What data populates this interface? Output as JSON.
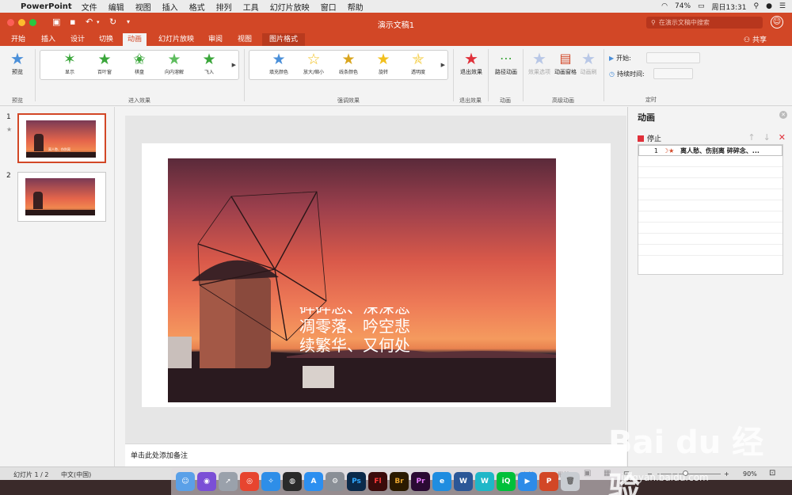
{
  "menubar": {
    "app_name": "PowerPoint",
    "items": [
      "文件",
      "编辑",
      "视图",
      "插入",
      "格式",
      "排列",
      "工具",
      "幻灯片放映",
      "窗口",
      "帮助"
    ],
    "battery": "74%",
    "clock": "周日13:31"
  },
  "window": {
    "title": "演示文稿1",
    "search_placeholder": "在演示文稿中搜索",
    "share_label": "共享"
  },
  "tabs": [
    "开始",
    "插入",
    "设计",
    "切换",
    "动画",
    "幻灯片放映",
    "审阅",
    "视图",
    "图片格式"
  ],
  "active_tab": "动画",
  "ribbon": {
    "preview": {
      "label": "预览",
      "group": "预览"
    },
    "entrance": {
      "group": "进入效果",
      "items": [
        "显示",
        "百叶窗",
        "棋盘",
        "向内溶解",
        "飞入"
      ]
    },
    "emphasis": {
      "group": "强调效果",
      "items": [
        "填充颜色",
        "放大/缩小",
        "线条颜色",
        "旋转",
        "透明度"
      ]
    },
    "exit": {
      "label": "退出效果",
      "group": "退出效果"
    },
    "path": {
      "label": "路径动画",
      "group": "动画"
    },
    "advanced": {
      "group": "高级动画",
      "effect_options": "效果选项",
      "animation_pane": "动画窗格",
      "animation_painter": "动画刷"
    },
    "timing": {
      "group": "定时",
      "start_label": "开始:",
      "duration_label": "持续时间:"
    }
  },
  "thumbnails": [
    {
      "number": "1",
      "caption": "离人愁、伤别离"
    },
    {
      "number": "2"
    }
  ],
  "slide": {
    "poem_clipped": "碎碎念、深深悲",
    "poem_lines": [
      "凋零落、吟空悲",
      "续繁华、又何处"
    ]
  },
  "notes_placeholder": "单击此处添加备注",
  "animation_pane": {
    "title": "动画",
    "stop_label": "停止",
    "entries": [
      {
        "order": "1",
        "text": "离人愁、伤别离 碎碎念、..."
      }
    ]
  },
  "statusbar": {
    "slide_info": "幻灯片 1 / 2",
    "language": "中文(中国)",
    "notes": "备注",
    "comments": "批注",
    "zoom_minus": "−",
    "zoom_plus": "+",
    "zoom": "90%"
  },
  "dock": {
    "icons": [
      "Finder",
      "Siri",
      "Launchpad",
      "Chrome",
      "Safari",
      "QQ",
      "App Store",
      "System Preferences",
      "Ps",
      "Fl",
      "Br",
      "Pr",
      "Browser",
      "W",
      "WPS",
      "iQIYI",
      "Video",
      "P",
      "Trash"
    ]
  },
  "watermark": {
    "brand": "Bai du 经验",
    "url": "jingyan.baidu.com"
  },
  "colors": {
    "accent": "#d24726",
    "green_star": "#3aa63a",
    "gold_star": "#f2c01e",
    "red_star": "#e0303a",
    "blue_star": "#4a8fd9"
  }
}
